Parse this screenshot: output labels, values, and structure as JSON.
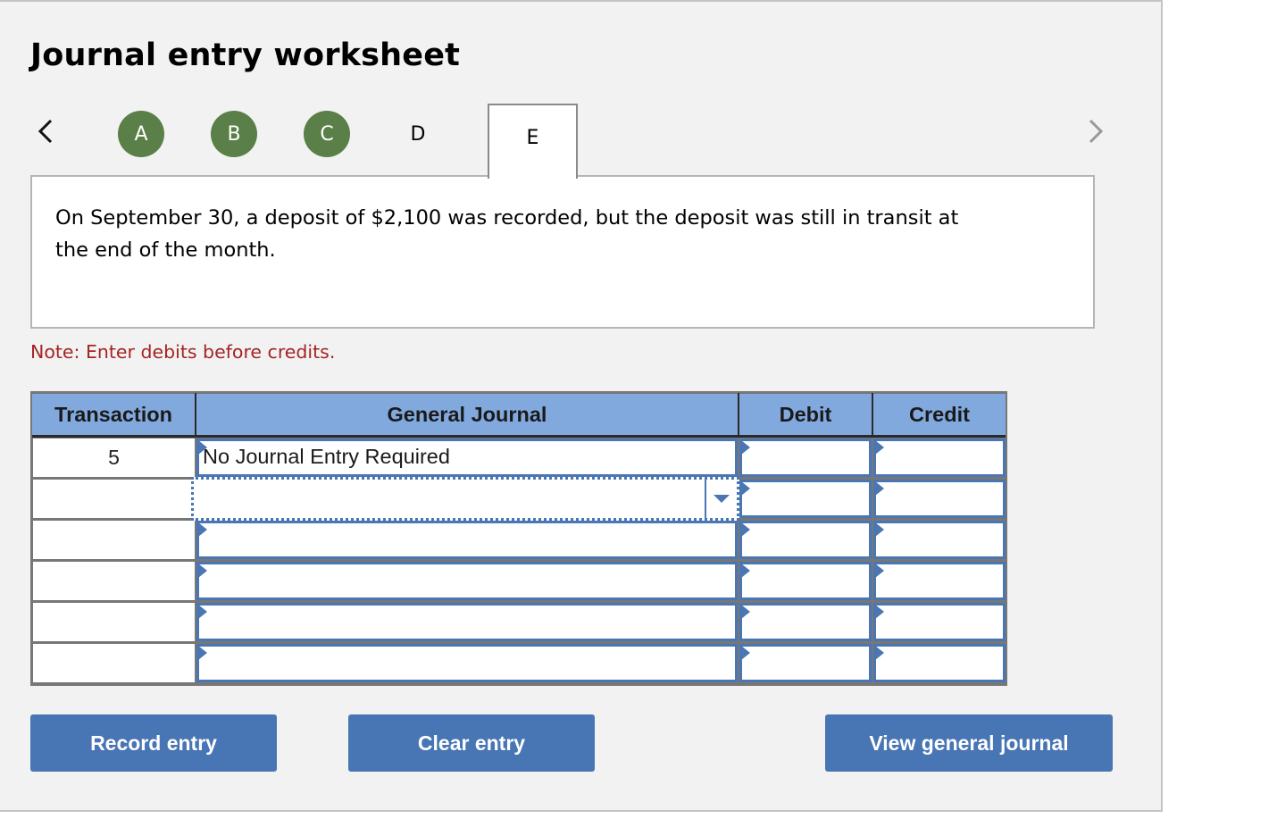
{
  "title": "Journal entry worksheet",
  "nav": {
    "prev_icon": "chevron-left-icon",
    "next_icon": "chevron-right-icon",
    "tabs": [
      {
        "label": "A",
        "status": "completed"
      },
      {
        "label": "B",
        "status": "completed"
      },
      {
        "label": "C",
        "status": "completed"
      },
      {
        "label": "D",
        "status": "pending"
      },
      {
        "label": "E",
        "status": "active"
      }
    ]
  },
  "description": "On September 30, a deposit of $2,100 was recorded, but the deposit was still in transit at the end of the month.",
  "note": "Note: Enter debits before credits.",
  "table": {
    "headers": [
      "Transaction",
      "General Journal",
      "Debit",
      "Credit"
    ],
    "rows": [
      {
        "transaction": "5",
        "account": "No Journal Entry Required",
        "debit": "",
        "credit": ""
      },
      {
        "transaction": "",
        "account": "",
        "debit": "",
        "credit": ""
      },
      {
        "transaction": "",
        "account": "",
        "debit": "",
        "credit": ""
      },
      {
        "transaction": "",
        "account": "",
        "debit": "",
        "credit": ""
      },
      {
        "transaction": "",
        "account": "",
        "debit": "",
        "credit": ""
      },
      {
        "transaction": "",
        "account": "",
        "debit": "",
        "credit": ""
      }
    ]
  },
  "buttons": {
    "record": "Record entry",
    "clear": "Clear entry",
    "view": "View general journal"
  },
  "colors": {
    "completed_tab": "#5a7f48",
    "header_bg": "#81a9de",
    "button_bg": "#4875b4",
    "note_text": "#a52424",
    "cell_border": "#4a76b4"
  }
}
